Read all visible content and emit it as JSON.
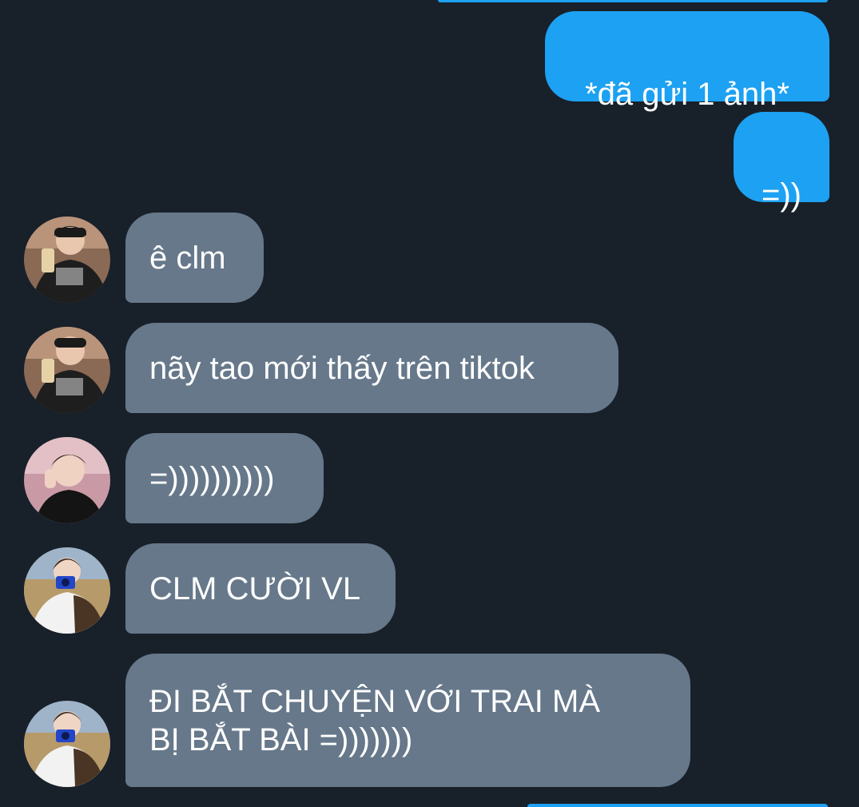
{
  "colors": {
    "background": "#18202a",
    "outgoing_bubble": "#1da1f2",
    "incoming_bubble": "#66788a",
    "text": "#ffffff"
  },
  "messages": [
    {
      "direction": "outgoing",
      "text": "*đã gửi 1 ảnh*"
    },
    {
      "direction": "outgoing",
      "text": "=))"
    },
    {
      "direction": "incoming",
      "sender_avatar": "user-a-avatar",
      "text": "ê clm"
    },
    {
      "direction": "incoming",
      "sender_avatar": "user-a-avatar",
      "text": "nãy tao mới thấy trên tiktok"
    },
    {
      "direction": "incoming",
      "sender_avatar": "user-b-avatar",
      "text": "=))))))))))"
    },
    {
      "direction": "incoming",
      "sender_avatar": "user-c-avatar",
      "text": "CLM CƯỜI VL"
    },
    {
      "direction": "incoming",
      "sender_avatar": "user-c-avatar",
      "text": "ĐI BẮT CHUYỆN VỚI TRAI MÀ\nBỊ BẮT BÀI =)))))))"
    }
  ]
}
